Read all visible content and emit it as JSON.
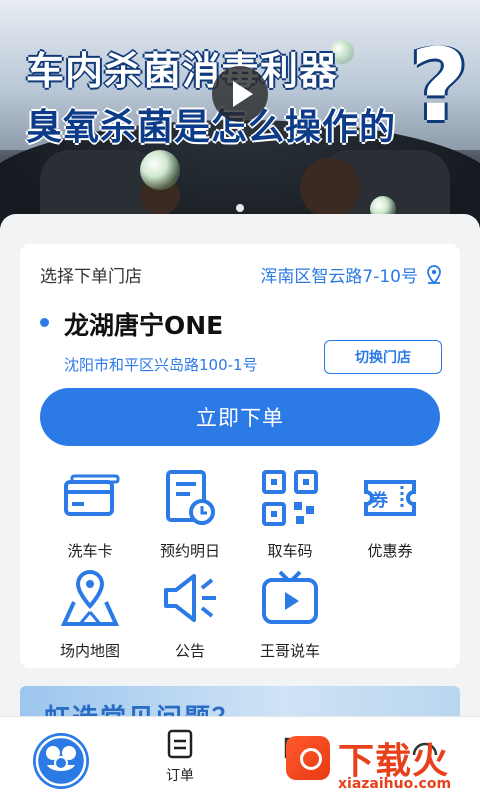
{
  "banner": {
    "line1": "车内杀菌消毒利器",
    "line2": "臭氧杀菌是怎么操作的",
    "question_mark": "?",
    "play_icon": "play-icon"
  },
  "store_card": {
    "select_label": "选择下单门店",
    "location_text": "浑南区智云路7-10号",
    "location_icon": "location-pin-icon",
    "store_name": "龙湖唐宁ONE",
    "store_address": "沈阳市和平区兴岛路100-1号",
    "switch_label": "切换门店",
    "order_label": "立即下单"
  },
  "services": [
    {
      "label": "洗车卡",
      "icon": "card-icon"
    },
    {
      "label": "预约明日",
      "icon": "calendar-icon"
    },
    {
      "label": "取车码",
      "icon": "qr-code-icon"
    },
    {
      "label": "优惠券",
      "icon": "coupon-icon"
    },
    {
      "label": "场内地图",
      "icon": "map-icon"
    },
    {
      "label": "公告",
      "icon": "megaphone-icon"
    },
    {
      "label": "王哥说车",
      "icon": "tv-play-icon"
    }
  ],
  "promo": {
    "text": "虹选常见问题？"
  },
  "bottom_nav": {
    "home_icon": "home-logo-icon",
    "order_label": "订单",
    "order_icon": "order-icon"
  },
  "watermark": {
    "title": "下载火",
    "url": "xiazaihuo.com"
  },
  "colors": {
    "accent": "#2b7ae6",
    "background": "#f2f3f5"
  }
}
